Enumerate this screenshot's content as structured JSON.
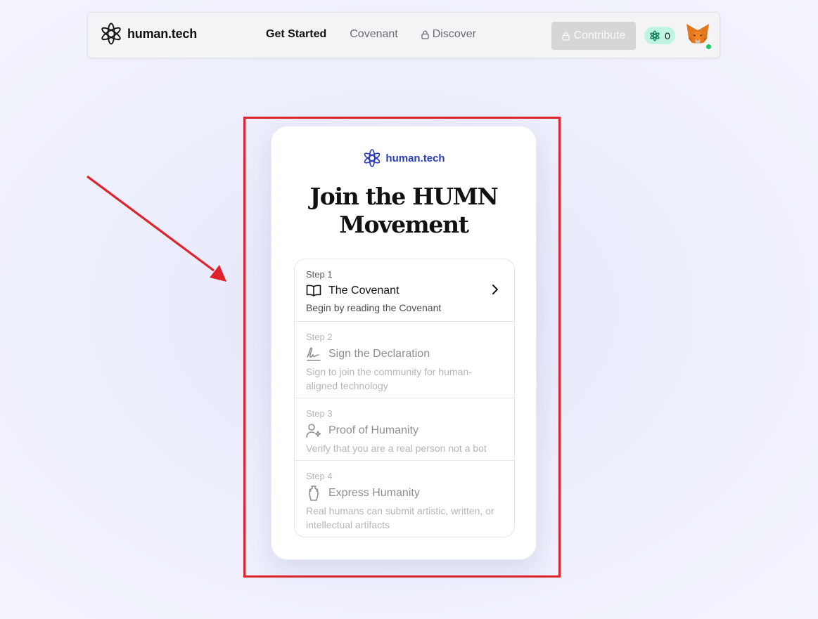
{
  "header": {
    "brand": "human.tech",
    "nav": [
      {
        "label": "Get Started",
        "active": true,
        "locked": false
      },
      {
        "label": "Covenant",
        "active": false,
        "locked": false
      },
      {
        "label": "Discover",
        "active": false,
        "locked": true
      }
    ],
    "contribute_label": "Contribute",
    "counter_value": "0",
    "avatar": "metamask-fox-icon"
  },
  "card": {
    "brand": "human.tech",
    "title_line1": "Join the HUMN",
    "title_line2": "Movement",
    "steps": [
      {
        "step": "Step 1",
        "title": "The Covenant",
        "description": "Begin by reading the Covenant",
        "icon": "book-open-icon",
        "enabled": true
      },
      {
        "step": "Step 2",
        "title": "Sign the Declaration",
        "description": "Sign to join the community for human-aligned technology",
        "icon": "signature-icon",
        "enabled": false
      },
      {
        "step": "Step 3",
        "title": "Proof of Humanity",
        "description": "Verify that you are a real person not a bot",
        "icon": "user-sparkle-icon",
        "enabled": false
      },
      {
        "step": "Step 4",
        "title": "Express Humanity",
        "description": "Real humans can submit artistic, written, or intellectual artifacts",
        "icon": "vase-icon",
        "enabled": false
      }
    ]
  },
  "colors": {
    "accent_blue": "#2a3bb8",
    "counter_bg": "#bff3e2",
    "highlight_red": "#e0232a",
    "online_green": "#18c964"
  }
}
